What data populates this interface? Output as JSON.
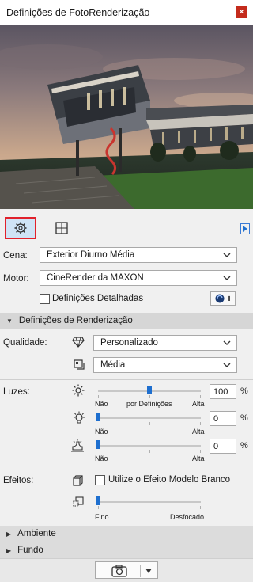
{
  "window": {
    "title": "Definições de FotoRenderização",
    "close_glyph": "×"
  },
  "scene": {
    "label": "Cena:",
    "value": "Exterior Diurno Média"
  },
  "engine": {
    "label": "Motor:",
    "value": "CineRender da MAXON"
  },
  "detailed": {
    "label": "Definições Detalhadas",
    "checked": false,
    "info_glyph": "i"
  },
  "render_section": {
    "title": "Definições de Renderização",
    "expanded": true
  },
  "quality": {
    "label": "Qualidade:",
    "preset_value": "Personalizado",
    "level_value": "Média"
  },
  "lights": {
    "label": "Luzes:",
    "sun": {
      "value": "100",
      "unit": "%",
      "min_label": "Não",
      "mid_label": "por Definições",
      "max_label": "Alta",
      "level": 0.5
    },
    "lamps": {
      "value": "0",
      "unit": "%",
      "min_label": "Não",
      "max_label": "Alta",
      "level": 0.0
    },
    "ambient": {
      "value": "0",
      "unit": "%",
      "min_label": "Não",
      "max_label": "Alta",
      "level": 0.0
    }
  },
  "effects": {
    "label": "Efeitos:",
    "white_model_label": "Utilize o Efeito Modelo Branco",
    "white_model_checked": false,
    "blur_min_label": "Fino",
    "blur_max_label": "Desfocado",
    "blur_level": 0.0
  },
  "sections": {
    "environment": "Ambiente",
    "background": "Fundo"
  },
  "colors": {
    "accent": "#1e6fcf",
    "selected_tab_border": "#e1212b",
    "close": "#c42b1c"
  }
}
